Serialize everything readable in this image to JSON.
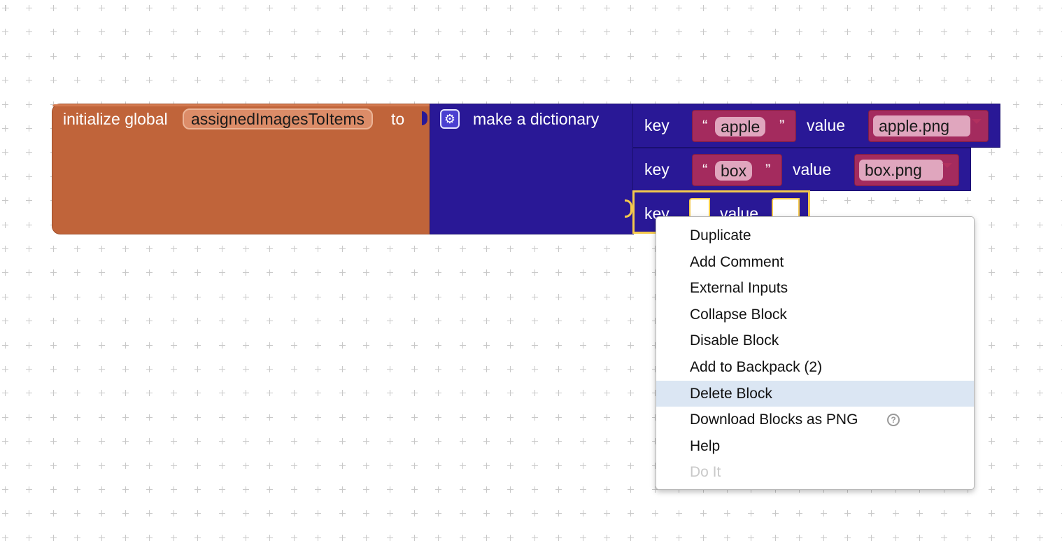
{
  "init_block": {
    "prefix": "initialize global",
    "variable": "assignedImagesToItems",
    "suffix": "to"
  },
  "dict_block": {
    "label": "make a dictionary",
    "gear_icon": "gear-icon"
  },
  "pairs": [
    {
      "key_label": "key",
      "key_value": "apple",
      "value_label": "value",
      "value_value": "apple.png"
    },
    {
      "key_label": "key",
      "key_value": "box",
      "value_label": "value",
      "value_value": "box.png"
    },
    {
      "key_label": "key",
      "value_label": "value"
    }
  ],
  "quote_open": "“",
  "quote_close": "”",
  "context_menu": {
    "items": [
      {
        "label": "Duplicate"
      },
      {
        "label": "Add Comment"
      },
      {
        "label": "External Inputs"
      },
      {
        "label": "Collapse Block"
      },
      {
        "label": "Disable Block"
      },
      {
        "label": "Add to Backpack (2)"
      },
      {
        "label": "Delete Block",
        "state": "highlighted"
      },
      {
        "label": "Download Blocks as PNG",
        "icon": "help-icon"
      },
      {
        "label": "Help"
      },
      {
        "label": "Do It",
        "state": "disabled"
      }
    ],
    "help_symbol": "?"
  },
  "colors": {
    "variable_block": "#c0643a",
    "dictionary_block": "#291896",
    "text_block": "#a42b5e",
    "selection": "#f4c94c",
    "menu_highlight": "#dbe6f3"
  }
}
